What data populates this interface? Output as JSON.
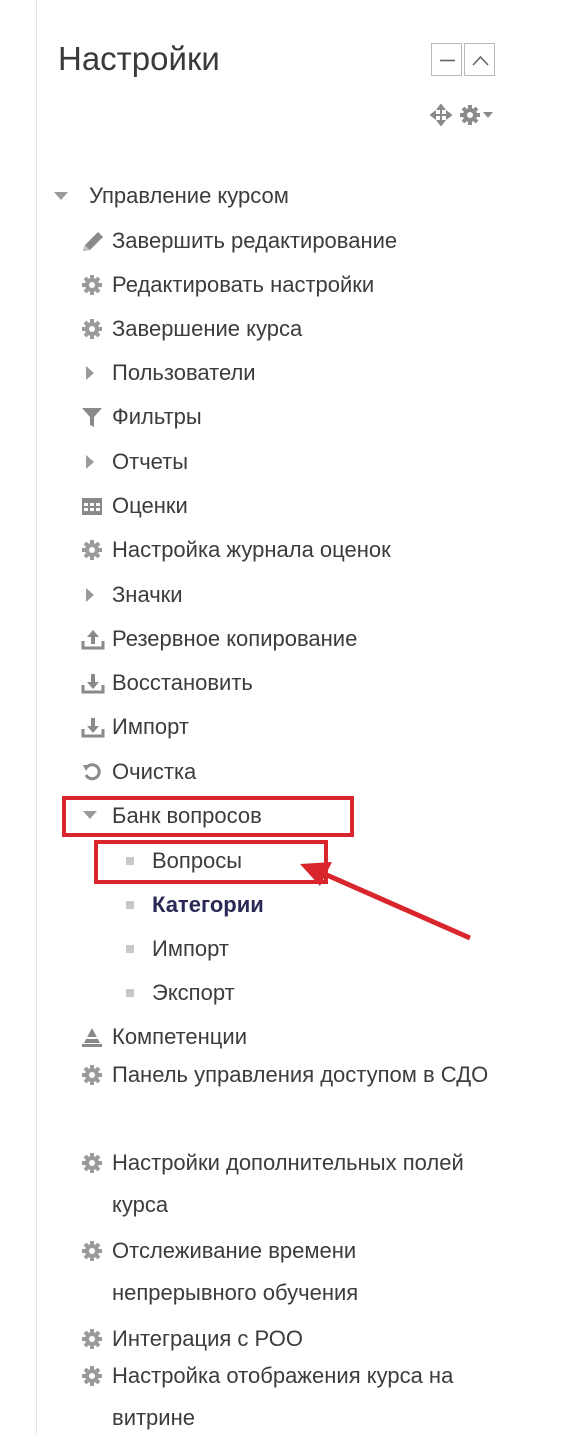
{
  "block": {
    "title": "Настройки"
  },
  "menu": {
    "root": "Управление курсом",
    "items": [
      {
        "label": "Завершить редактирование",
        "icon": "pencil-icon"
      },
      {
        "label": "Редактировать настройки",
        "icon": "gear-icon"
      },
      {
        "label": "Завершение курса",
        "icon": "gear-icon"
      },
      {
        "label": "Пользователи",
        "icon": "triangle-right-icon"
      },
      {
        "label": "Фильтры",
        "icon": "filter-icon"
      },
      {
        "label": "Отчеты",
        "icon": "triangle-right-icon"
      },
      {
        "label": "Оценки",
        "icon": "table-icon"
      },
      {
        "label": "Настройка журнала оценок",
        "icon": "gear-icon"
      },
      {
        "label": "Значки",
        "icon": "triangle-right-icon"
      },
      {
        "label": "Резервное копирование",
        "icon": "upload-icon"
      },
      {
        "label": "Восстановить",
        "icon": "download-icon"
      },
      {
        "label": "Импорт",
        "icon": "download-icon"
      },
      {
        "label": "Очистка",
        "icon": "refresh-icon"
      },
      {
        "label": "Банк вопросов",
        "icon": "triangle-down-icon"
      }
    ],
    "question_bank": [
      {
        "label": "Вопросы"
      },
      {
        "label": "Категории"
      },
      {
        "label": "Импорт"
      },
      {
        "label": "Экспорт"
      }
    ],
    "after": [
      {
        "label": "Компетенции",
        "icon": "competency-icon"
      },
      {
        "label": "Панель управления доступом в СДО",
        "icon": "gear-icon"
      },
      {
        "label": "Настройки дополнительных полей курса",
        "icon": "gear-icon"
      },
      {
        "label": "Отслеживание времени непрерывного обучения",
        "icon": "gear-icon"
      },
      {
        "label": "Интеграция с РОО",
        "icon": "gear-icon"
      },
      {
        "label": "Настройка отображения курса на витрине",
        "icon": "gear-icon"
      }
    ]
  },
  "colors": {
    "highlight": "#d9262c",
    "icon": "#8a8a8a"
  }
}
